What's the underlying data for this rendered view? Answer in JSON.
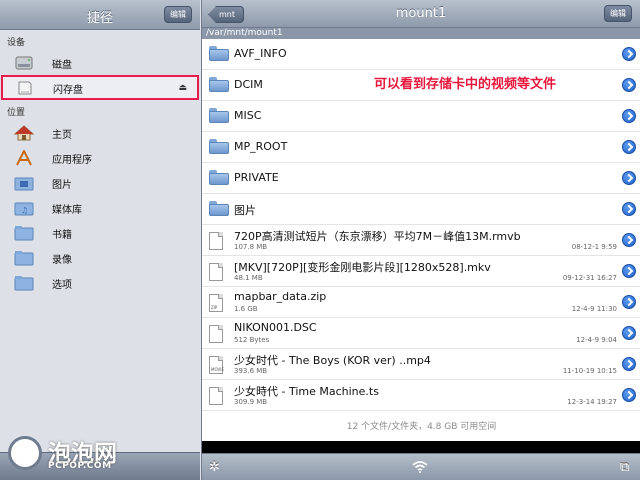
{
  "sidebar": {
    "title": "捷径",
    "edit_label": "编辑",
    "section_devices": "设备",
    "devices": [
      {
        "label": "磁盘",
        "icon": "disk-icon"
      },
      {
        "label": "闪存盘",
        "icon": "flash-drive-icon",
        "highlighted": true,
        "eject_icon": "⏏"
      }
    ],
    "section_places": "位置",
    "places": [
      {
        "label": "主页",
        "icon": "home-icon"
      },
      {
        "label": "应用程序",
        "icon": "applications-icon"
      },
      {
        "label": "图片",
        "icon": "pictures-folder-icon"
      },
      {
        "label": "媒体库",
        "icon": "media-folder-icon"
      },
      {
        "label": "书籍",
        "icon": "books-folder-icon"
      },
      {
        "label": "录像",
        "icon": "video-folder-icon"
      },
      {
        "label": "选项",
        "icon": "options-folder-icon"
      }
    ]
  },
  "watermark": {
    "big": "泡泡网",
    "small": "PCPOP.COM"
  },
  "main": {
    "back_label": "mnt",
    "title": "mount1",
    "edit_label": "编辑",
    "path": "/var/mnt/mount1",
    "annotation": "可以看到存储卡中的视频等文件",
    "folders": [
      "AVF_INFO",
      "DCIM",
      "MISC",
      "MP_ROOT",
      "PRIVATE",
      "图片"
    ],
    "files": [
      {
        "name": "720P高清测试短片（东京漂移）平均7M－峰值13M.rmvb",
        "size": "107.8 MB",
        "date": "08-12-1 9:59",
        "tag": ""
      },
      {
        "name": "[MKV][720P][变形金刚电影片段][1280x528].mkv",
        "size": "48.1 MB",
        "date": "09-12-31 16:27",
        "tag": ""
      },
      {
        "name": "mapbar_data.zip",
        "size": "1.6 GB",
        "date": "12-4-9 11:30",
        "tag": "ZIP"
      },
      {
        "name": "NIKON001.DSC",
        "size": "512 Bytes",
        "date": "12-4-9 9:04",
        "tag": ""
      },
      {
        "name": "少女时代 - The Boys (KOR ver) ..mp4",
        "size": "393.6 MB",
        "date": "11-10-19 10:15",
        "tag": "MOVIE"
      },
      {
        "name": "少女時代 - Time Machine.ts",
        "size": "309.9 MB",
        "date": "12-3-14 19:27",
        "tag": ""
      }
    ],
    "footer_count": "12 个文件/文件夹，4.8 GB 可用空间"
  },
  "toolbar": {
    "settings_icon": "✲",
    "wifi_icon": "wifi-icon",
    "window_icon": "⧉"
  },
  "colors": {
    "highlight": "#ea1b4e",
    "annotation": "#e7163d",
    "disclosure": "#2a6fd6"
  }
}
